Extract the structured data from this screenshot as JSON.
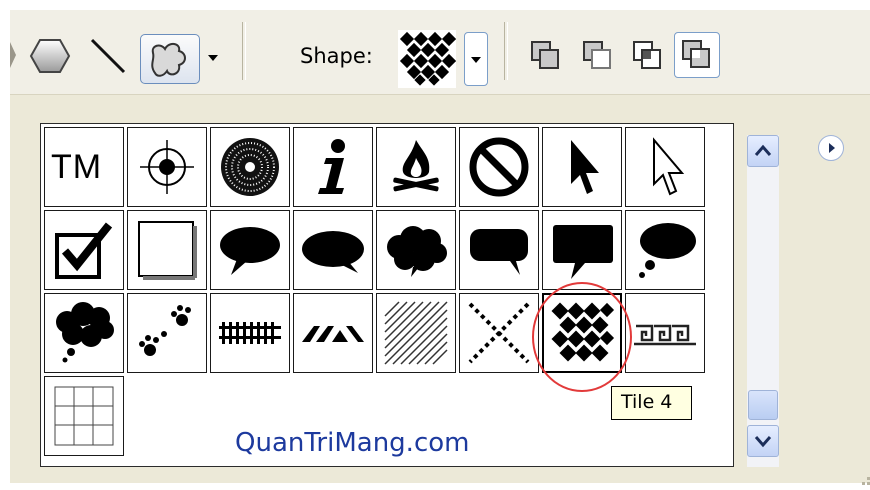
{
  "toolbar": {
    "tools": [
      {
        "name": "polygon-tool",
        "icon": "hexagon-icon"
      },
      {
        "name": "line-tool",
        "icon": "line-icon"
      },
      {
        "name": "custom-shape-tool",
        "icon": "custom-shape-icon"
      }
    ],
    "shape_label": "Shape:",
    "current_shape": "Tile 4",
    "combine_modes": [
      {
        "name": "add-to-area",
        "icon": "add-area-icon"
      },
      {
        "name": "subtract-from-area",
        "icon": "subtract-area-icon"
      },
      {
        "name": "intersect-area",
        "icon": "intersect-area-icon"
      },
      {
        "name": "exclude-overlap",
        "icon": "exclude-overlap-icon"
      }
    ]
  },
  "shape_picker": {
    "rows": [
      [
        {
          "label": "TM",
          "icon": "trademark-icon"
        },
        {
          "icon": "target-icon"
        },
        {
          "icon": "radial-burst-icon"
        },
        {
          "icon": "info-icon"
        },
        {
          "icon": "campfire-icon"
        },
        {
          "icon": "no-sign-icon"
        },
        {
          "icon": "arrow-cursor-filled-icon"
        },
        {
          "icon": "arrow-cursor-outline-icon"
        }
      ],
      [
        {
          "icon": "checkbox-checked-icon"
        },
        {
          "icon": "square-frame-icon"
        },
        {
          "icon": "speech-bubble-icon"
        },
        {
          "icon": "speech-bubble-oval-icon"
        },
        {
          "icon": "thought-cloud-icon"
        },
        {
          "icon": "talk-bubble-rounded-icon"
        },
        {
          "icon": "talk-bubble-square-icon"
        },
        {
          "icon": "thought-bubble-icon"
        }
      ],
      [
        {
          "icon": "cloud-thought-icon"
        },
        {
          "icon": "paw-prints-icon"
        },
        {
          "icon": "rail-fence-icon"
        },
        {
          "icon": "chevron-band-icon"
        },
        {
          "icon": "hatch-lines-icon"
        },
        {
          "icon": "cross-dots-icon"
        },
        {
          "icon": "tile-checker-icon",
          "selected": true,
          "tooltip": "Tile 4"
        },
        {
          "icon": "greek-key-icon"
        }
      ],
      [
        {
          "icon": "grid-tile-icon"
        }
      ]
    ]
  },
  "watermark": "QuanTriMang.com",
  "tooltip": "Tile 4",
  "colors": {
    "panel": "#ece9d8",
    "highlight_circle": "#e23a3a",
    "watermark": "#1d3a9e",
    "tooltip_bg": "#ffffe1"
  }
}
